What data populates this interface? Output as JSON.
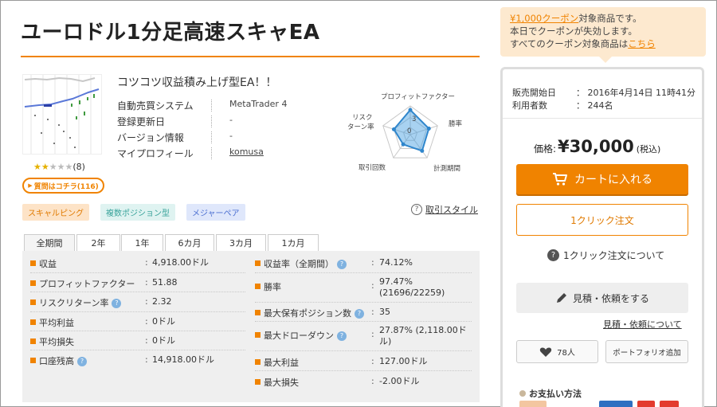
{
  "title": "ユーロドル1分足高速スキャEA",
  "subtitle": "コツコツ収益積み上げ型EA！！",
  "rating": {
    "stars_filled": 2,
    "stars_total": 5,
    "count_text": "(8)"
  },
  "qa_button": "質問はコチラ(116)",
  "info": [
    {
      "label": "自動売買システム",
      "value": "MetaTrader 4",
      "link": false
    },
    {
      "label": "登録更新日",
      "value": "-",
      "link": false
    },
    {
      "label": "バージョン情報",
      "value": "-",
      "link": false
    },
    {
      "label": "マイプロフィール",
      "value": "komusa",
      "link": true
    }
  ],
  "radar": {
    "axes": [
      "プロフィットファクター",
      "勝率",
      "計測期間",
      "取引回数",
      "リスクリターン率"
    ],
    "tick_labels": [
      "3",
      "0"
    ],
    "scale_max": 5,
    "values": [
      4.3,
      3.4,
      3.5,
      2.1,
      3.0
    ]
  },
  "tags": [
    "スキャルピング",
    "複数ポジション型",
    "メジャーペア"
  ],
  "style_link": "取引スタイル",
  "tabs": [
    "全期間",
    "2年",
    "1年",
    "6カ月",
    "3カ月",
    "1カ月"
  ],
  "stats_left": [
    {
      "label": "収益",
      "value": "4,918.00ドル",
      "help": false
    },
    {
      "label": "プロフィットファクター",
      "value": "51.88",
      "help": false
    },
    {
      "label": "リスクリターン率",
      "value": "2.32",
      "help": true
    },
    {
      "label": "平均利益",
      "value": "0ドル",
      "help": false
    },
    {
      "label": "平均損失",
      "value": "0ドル",
      "help": false
    },
    {
      "label": "口座残高",
      "value": "14,918.00ドル",
      "help": true
    }
  ],
  "stats_right": [
    {
      "label": "収益率（全期間）",
      "value": "74.12%",
      "help": true
    },
    {
      "label": "勝率",
      "value": "97.47%",
      "value2": "(21696/22259)",
      "help": false
    },
    {
      "label": "最大保有ポジション数",
      "value": "35",
      "help": true
    },
    {
      "label": "最大ドローダウン",
      "value": "27.87% (2,118.00ド",
      "value2": "ル)",
      "help": true
    },
    {
      "label": "最大利益",
      "value": "127.00ドル",
      "help": false
    },
    {
      "label": "最大損失",
      "value": "-2.00ドル",
      "help": false
    }
  ],
  "coupon": {
    "highlight": "¥1,000クーポン",
    "line1_rest": "対象商品です。",
    "line2": "本日でクーポンが失効します。",
    "line3_pre": "すべてのクーポン対象商品は",
    "line3_link": "こちら"
  },
  "sale": {
    "start_label": "販売開始日",
    "start_value": "：  2016年4月14日 11時41分",
    "users_label": "利用者数",
    "users_value": "：  244名"
  },
  "price": {
    "label": "価格:",
    "value": "¥30,000",
    "tax": "(税込)"
  },
  "cart_button": "カートに入れる",
  "oneclick_button": "1クリック注文",
  "oneclick_about": "1クリック注文について",
  "estimate_button": "見積・依頼をする",
  "estimate_link": "見積・依頼について",
  "like_button": "78人",
  "portfolio_button": "ポートフォリオ追加",
  "payment_title": "お支払い方法",
  "colors": {
    "accent": "#f08300",
    "tag_scalping": "#fde3c7",
    "tag_multi": "#dff3f1",
    "tag_major": "#dfe7fb",
    "radar_fill": "#3f9be0"
  },
  "icons": [
    "cart-icon",
    "pencil-icon",
    "heart-icon",
    "help-icon",
    "star-icon"
  ]
}
